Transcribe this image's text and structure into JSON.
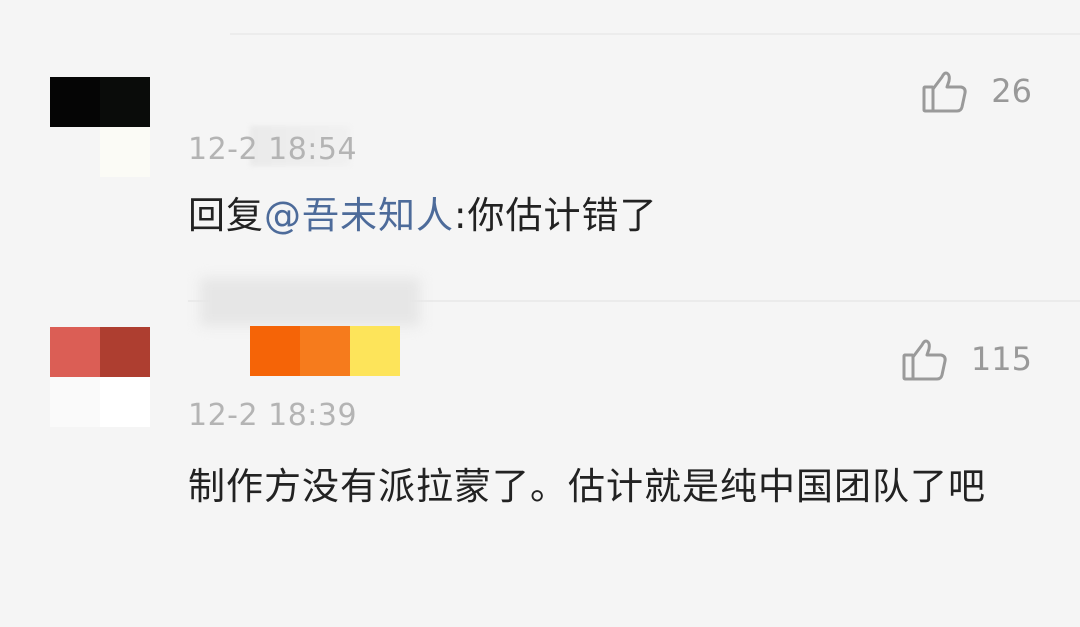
{
  "comments": [
    {
      "time": "12-2 18:54",
      "reply_prefix": "回复",
      "mention": "@吾未知人",
      "text": ":你估计错了",
      "likes": "26",
      "icon": "thumbs-up-icon"
    },
    {
      "time": "12-2 18:39",
      "text": "制作方没有派拉蒙了。估计就是纯中国团队了吧",
      "likes": "115",
      "icon": "thumbs-up-icon"
    }
  ],
  "colors": {
    "mention": "#4d6b9a",
    "text": "#222222",
    "meta": "#b4b4b4",
    "background": "#f5f5f5"
  }
}
